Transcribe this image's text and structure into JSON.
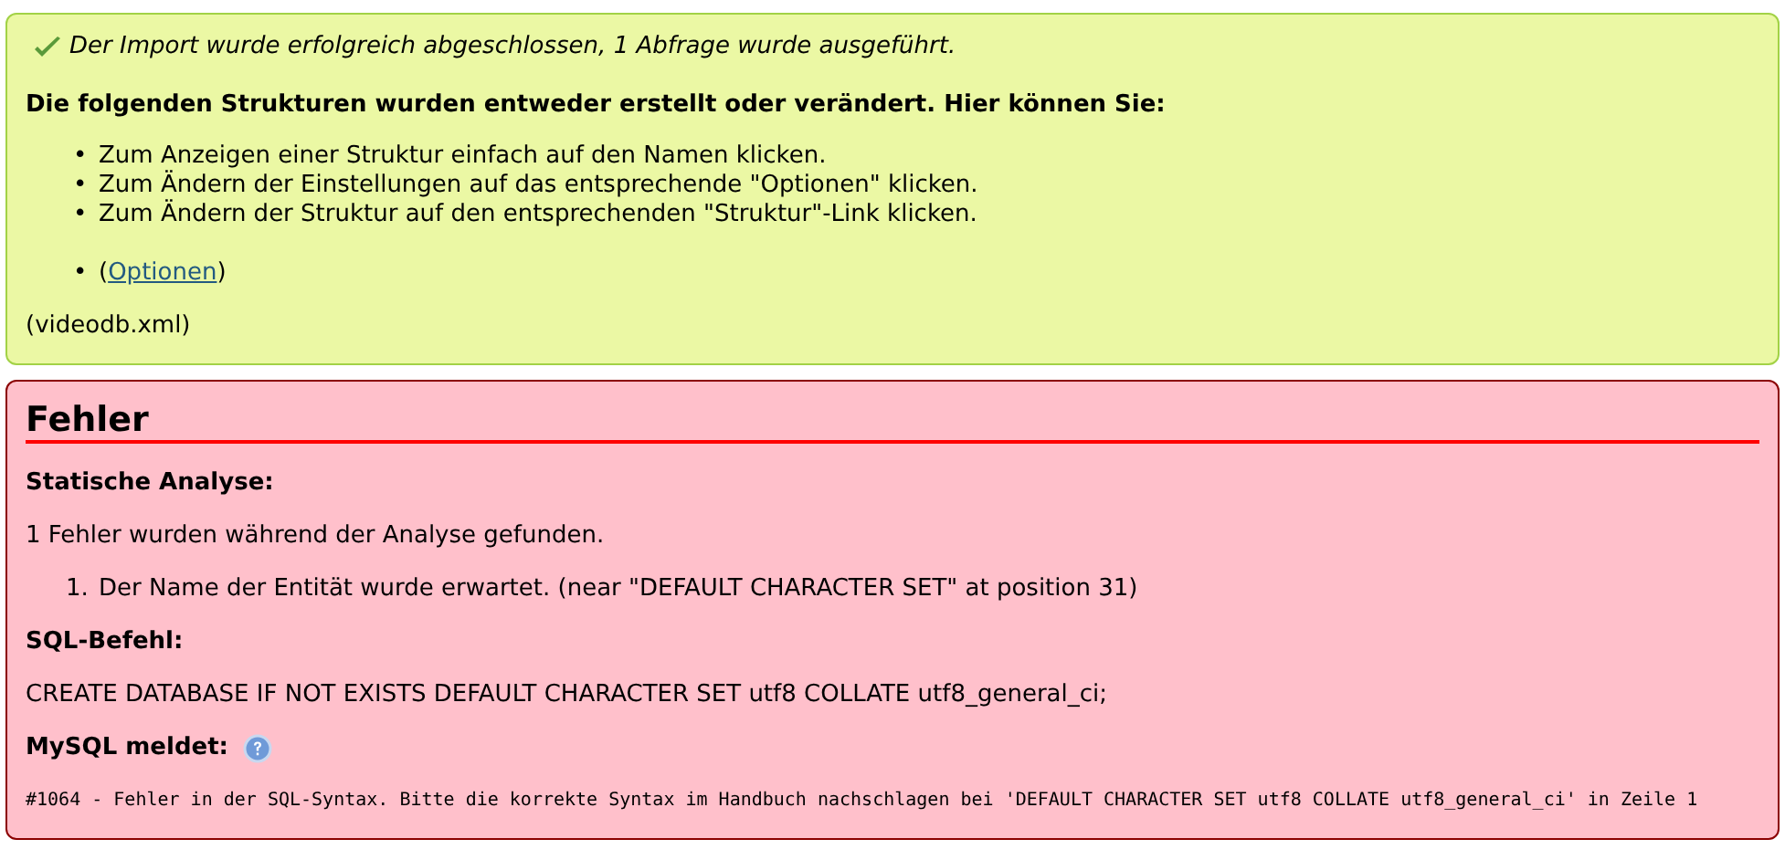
{
  "success": {
    "message": "Der Import wurde erfolgreich abgeschlossen, 1 Abfrage wurde ausgeführt.",
    "heading": "Die folgenden Strukturen wurden entweder erstellt oder verändert. Hier können Sie:",
    "hints": [
      {
        "marker": "•",
        "text": "Zum Anzeigen einer Struktur einfach auf den Namen klicken."
      },
      {
        "marker": "•",
        "text": "Zum Ändern der Einstellungen auf das entsprechende \"Optionen\" klicken."
      },
      {
        "marker": "•",
        "text": "Zum Ändern der Struktur auf den entsprechenden \"Struktur\"-Link klicken."
      }
    ],
    "options_item": {
      "marker": "•",
      "open": "(",
      "link": "Optionen",
      "close": ")"
    },
    "file": "(videodb.xml)"
  },
  "error": {
    "title": "Fehler",
    "analysis_label": "Statische Analyse:",
    "analysis_summary": "1 Fehler wurden während der Analyse gefunden.",
    "analysis_errors": [
      {
        "marker": "1.",
        "text": "Der Name der Entität wurde erwartet. (near \"DEFAULT CHARACTER SET\" at position 31)"
      }
    ],
    "sql_label": "SQL-Befehl:",
    "sql": "CREATE DATABASE IF NOT EXISTS DEFAULT CHARACTER SET utf8 COLLATE utf8_general_ci;",
    "mysql_label": "MySQL meldet:",
    "mysql_message": "#1064 - Fehler in der SQL-Syntax. Bitte die korrekte Syntax im Handbuch nachschlagen bei 'DEFAULT CHARACTER SET utf8 COLLATE utf8_general_ci' in Zeile 1"
  }
}
